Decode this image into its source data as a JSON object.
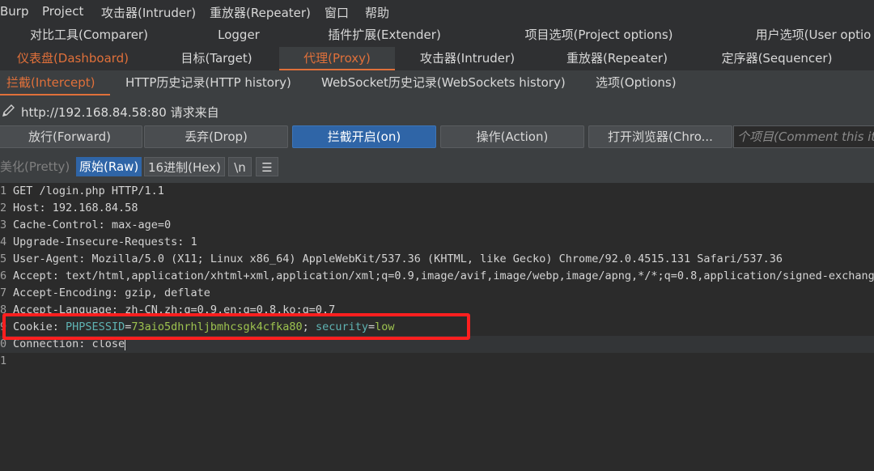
{
  "menubar": [
    "Burp",
    "Project",
    "攻击器(Intruder)",
    "重放器(Repeater)",
    "窗口",
    "帮助"
  ],
  "tabs_row1": [
    "对比工具(Comparer)",
    "Logger",
    "插件扩展(Extender)",
    "项目选项(Project options)",
    "用户选项(User optio"
  ],
  "tabs_row2": [
    "仪表盘(Dashboard)",
    "目标(Target)",
    "代理(Proxy)",
    "攻击器(Intruder)",
    "重放器(Repeater)",
    "定序器(Sequencer)"
  ],
  "proxy_tabs": [
    "拦截(Intercept)",
    "HTTP历史记录(HTTP history)",
    "WebSocket历史记录(WebSockets history)",
    "选项(Options)"
  ],
  "intercept": {
    "url_text": "http://192.168.84.58:80 请求来自",
    "buttons": [
      "放行(Forward)",
      "丢弃(Drop)",
      "拦截开启(on)",
      "操作(Action)",
      "打开浏览器(Chro..."
    ],
    "comment_placeholder": "个项目(Comment this it"
  },
  "view_tabs": [
    "美化(Pretty)",
    "原始(Raw)",
    "16进制(Hex)",
    "\\n"
  ],
  "request": {
    "line_numbers": [
      "1",
      "2",
      "3",
      "4",
      "5",
      "6",
      "7",
      "8",
      "9",
      "0",
      "1"
    ],
    "lines": [
      {
        "key": "",
        "sep": "",
        "value": "GET /login.php HTTP/1.1"
      },
      {
        "key": "Host",
        "sep": ": ",
        "value": "192.168.84.58"
      },
      {
        "key": "Cache-Control",
        "sep": ": ",
        "value": "max-age=0"
      },
      {
        "key": "Upgrade-Insecure-Requests",
        "sep": ": ",
        "value": "1"
      },
      {
        "key": "User-Agent",
        "sep": ": ",
        "value": "Mozilla/5.0 (X11; Linux x86_64) AppleWebKit/537.36 (KHTML, like Gecko) Chrome/92.0.4515.131 Safari/537.36"
      },
      {
        "key": "Accept",
        "sep": ": ",
        "value": "text/html,application/xhtml+xml,application/xml;q=0.9,image/avif,image/webp,image/apng,*/*;q=0.8,application/signed-exchange;"
      },
      {
        "key": "Accept-Encoding",
        "sep": ": ",
        "value": "gzip, deflate"
      },
      {
        "key": "Accept-Language",
        "sep": ": ",
        "value": "zh-CN,zh;q=0.9,en;q=0.8,ko;q=0.7"
      },
      {
        "key": "Cookie",
        "sep": ": ",
        "value": ""
      },
      {
        "key": "Connection",
        "sep": ": ",
        "value": "close"
      },
      {
        "key": "",
        "sep": "",
        "value": ""
      }
    ],
    "cookie": {
      "name1": "PHPSESSID",
      "eq": "=",
      "value1": "73aio5dhrhljbmhcsgk4cfka80",
      "semi": "; ",
      "name2": "security",
      "value2": "low"
    }
  },
  "colors": {
    "accent": "#e0703a",
    "primary_button": "#2f65a7",
    "highlight_box": "#ff1f1f"
  }
}
